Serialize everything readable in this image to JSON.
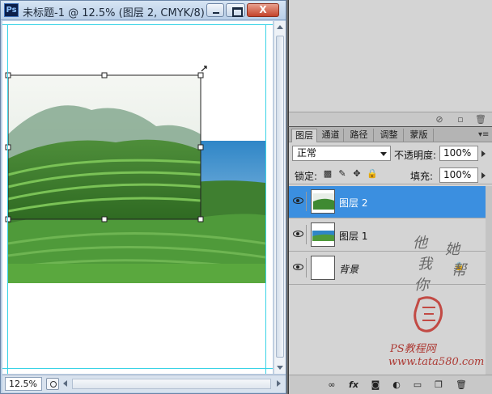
{
  "document": {
    "title": "未标题-1 @ 12.5% (图层 2, CMYK/8) *",
    "app_badge": "Ps",
    "close_glyph": "X",
    "zoom": "12.5%"
  },
  "layers_panel": {
    "tabs": [
      "图层",
      "通道",
      "路径",
      "调整",
      "蒙版"
    ],
    "active_tab": 0,
    "blend_mode": "正常",
    "opacity_label": "不透明度:",
    "opacity_value": "100%",
    "lock_label": "锁定:",
    "fill_label": "填充:",
    "fill_value": "100%",
    "layers": [
      {
        "name": "图层 2",
        "selected": true
      },
      {
        "name": "图层 1",
        "selected": false
      },
      {
        "name": "背景",
        "selected": false,
        "locked": true
      }
    ],
    "bottom_icons": [
      "link-icon",
      "fx-icon",
      "mask-icon",
      "adjustment-icon",
      "folder-icon",
      "new-layer-icon",
      "trash-icon"
    ],
    "fx_label": "fx"
  },
  "watermark": {
    "chars": [
      "他",
      "她",
      "我",
      "帮",
      "你"
    ],
    "site": "PS教程网",
    "url": "www.tata580.com"
  },
  "colors": {
    "selection": "#3b8fe0",
    "guide": "#39d3e6",
    "panel": "#d4d4d4"
  }
}
